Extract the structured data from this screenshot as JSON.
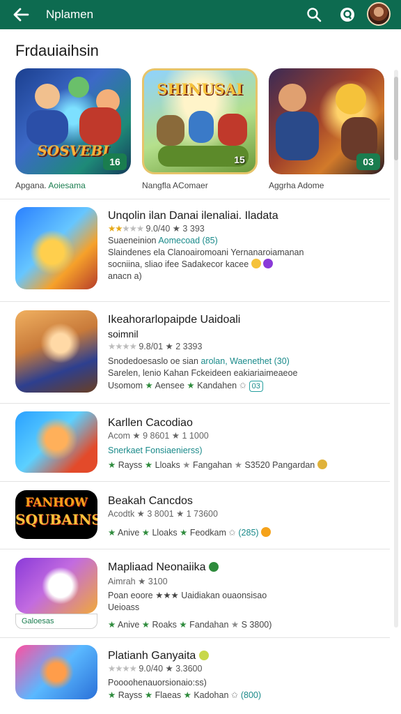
{
  "appbar": {
    "title": "Nplamen",
    "back_icon": "arrow-back-icon",
    "search_icon": "search-icon",
    "play_icon": "play-games-icon",
    "bg": "#0d6b50"
  },
  "section": {
    "title": "Frdauiaihsin"
  },
  "featured": [
    {
      "thumb_text": "SOSVEBI",
      "badge": "16",
      "caption_a": "Apgana.",
      "caption_b": "Aoiesama"
    },
    {
      "thumb_text": "SHINUSAI",
      "badge": "15",
      "caption_a": "Nangfla AComaer",
      "caption_b": ""
    },
    {
      "thumb_text": "",
      "badge": "03",
      "caption_a": "Aggrha Adome",
      "caption_b": ""
    }
  ],
  "apps": [
    {
      "name": "Unqolin ilan Danai ilenaliai. Iladata",
      "rating": "9.0/40 ★ 3 393",
      "line1_a": "Suaeneinion",
      "line1_b": "Aomecoad (85)",
      "line2": "Slaindenes ela Clanoairomoani Yernanaroiamanan",
      "line3": "socniina, sliao ifee Sadakecor kacee",
      "line4": "anacn a)"
    },
    {
      "name": "Ikeahorarlopaipde Uaidoali",
      "subname": "soimnil",
      "rating": "9.8/01 ★ 2 3393",
      "line1_a": "Snodedoesaslo oe sian",
      "line1_b": "arolan, Waenethet (30)",
      "line2": "Sarelen, lenio Kahan Fckeideen eakiariaimeaeoe",
      "tags": [
        "Usomom",
        "Aensee",
        "Kandahen"
      ],
      "pill": "03"
    },
    {
      "name": "Karllen Cacodiao",
      "rating": "Acom ★ 9 8601 ★ 1 1000",
      "line1": "Snerkaet Fonsiaenierss)",
      "tags": [
        "Rayss",
        "Lloaks",
        "Fangahan",
        "S3520 Pangardan"
      ]
    },
    {
      "name": "Beakah Cancdos",
      "rating": "Acodtk ★ 3 8001 ★ 1 73600",
      "tags": [
        "Anive",
        "Lloaks",
        "Feodkam"
      ],
      "pill": "(285)"
    },
    {
      "name": "Mapliaad Neonaiika",
      "rating": "Aimrah ★ 3100",
      "line1": "Poan eoore ★★★ Uaidiakan ouaonsisao",
      "line2": "Ueioass",
      "tags": [
        "Anive",
        "Roaks",
        "Fandahan",
        "S 3800)"
      ],
      "overlay": "Galoesas"
    },
    {
      "name": "Platianh Ganyaita",
      "rating": "9.0/40 ★ 3.3600",
      "line1": "Poooohenauorsionaio:ss)",
      "tags": [
        "Rayss",
        "Flaeas",
        "Kadohan"
      ],
      "pill": "(800)"
    }
  ]
}
